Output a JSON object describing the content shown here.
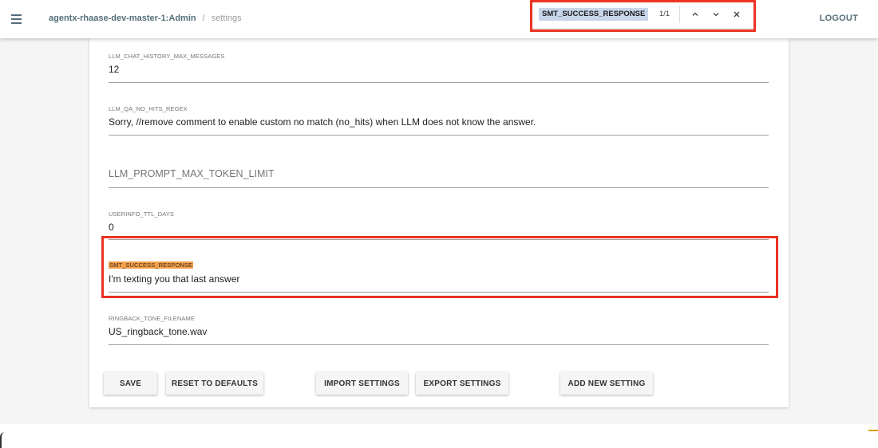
{
  "header": {
    "app_name": "agentx-rhaase-dev-master-1:Admin",
    "separator": "/",
    "page": "settings",
    "logout_label": "LOGOUT",
    "menu_icon": "menu-icon"
  },
  "find_bar": {
    "query": "SMT_SUCCESS_RESPONSE",
    "count": "1/1",
    "highlight_color": "#c9d6ea",
    "border_color": "#ea3323"
  },
  "fields": [
    {
      "label": "LLM_CHAT_HISTORY_MAX_MESSAGES",
      "value": "12"
    },
    {
      "label": "LLM_QA_NO_HITS_REGEX",
      "value": "Sorry,  //remove comment to enable custom no match (no_hits) when LLM does not know the answer."
    },
    {
      "placeholder": "LLM_PROMPT_MAX_TOKEN_LIMIT",
      "value": ""
    },
    {
      "label": "USERINFO_TTL_DAYS",
      "value": "0"
    },
    {
      "label": "SMT_SUCCESS_RESPONSE",
      "value": "I'm texting you that last answer",
      "highlight_color": "#f5a04b"
    },
    {
      "label": "RINGBACK_TONE_FILENAME",
      "value": "US_ringback_tone.wav"
    }
  ],
  "buttons": {
    "save": "SAVE",
    "reset": "RESET TO DEFAULTS",
    "import": "IMPORT SETTINGS",
    "export": "EXPORT SETTINGS",
    "add_new": "ADD NEW SETTING"
  }
}
